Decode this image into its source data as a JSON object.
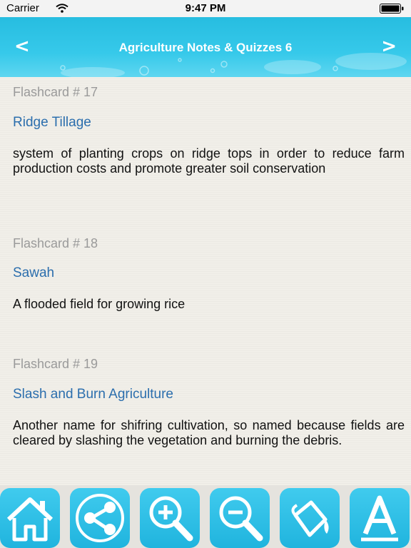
{
  "status_bar": {
    "carrier": "Carrier",
    "time": "9:47 PM"
  },
  "header": {
    "title": "Agriculture Notes & Quizzes 6",
    "back_icon": "<",
    "forward_icon": ">"
  },
  "flashcards": [
    {
      "number": "Flashcard # 17",
      "term": "Ridge Tillage",
      "definition": "system of planting crops on ridge tops in order to reduce farm production costs and promote greater soil conservation"
    },
    {
      "number": "Flashcard # 18",
      "term": "Sawah",
      "definition": "A flooded field for growing rice"
    },
    {
      "number": "Flashcard # 19",
      "term": "Slash and Burn Agriculture",
      "definition": "Another name for shifring cultivation, so named because fields are cleared by slashing the vegetation and burning the debris."
    }
  ],
  "toolbar": {
    "buttons": [
      "home-icon",
      "share-icon",
      "zoom-in-icon",
      "zoom-out-icon",
      "paint-bucket-icon",
      "font-icon"
    ]
  },
  "colors": {
    "header": "#27bde0",
    "term": "#2b6ead",
    "flashcard_number": "#9a9a9a",
    "toolbar_button": "#2cbde4"
  }
}
